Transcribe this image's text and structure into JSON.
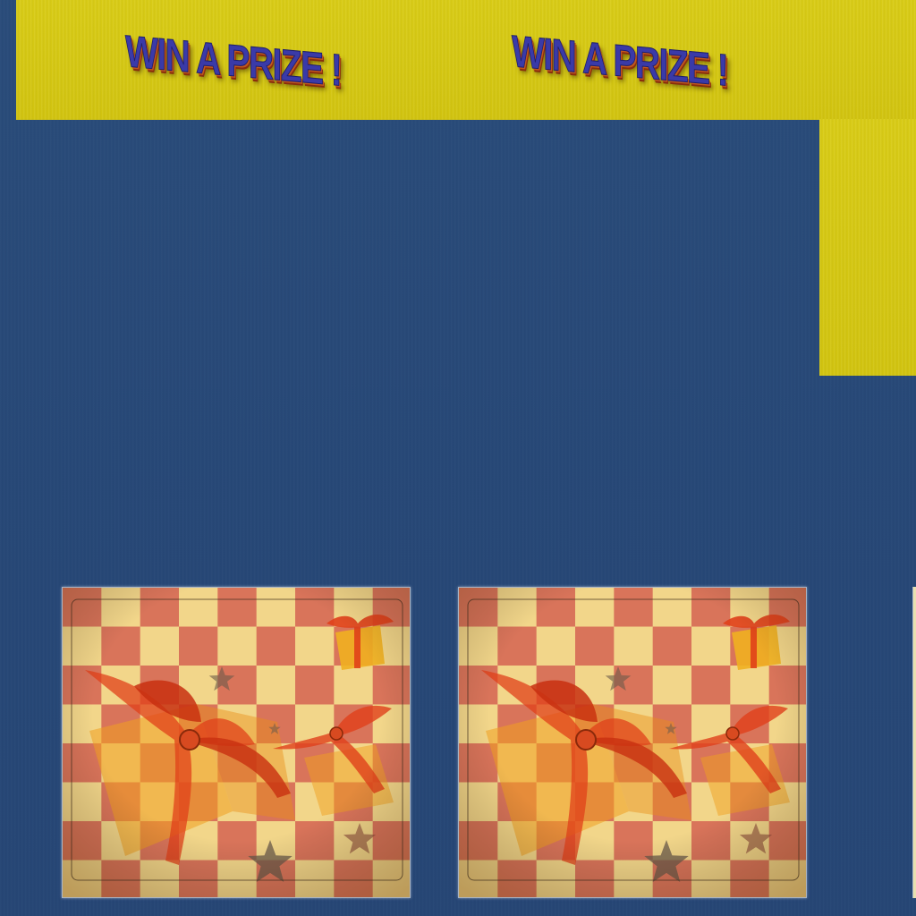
{
  "banner": {
    "titles": [
      "WIN A PRIZE !",
      "WIN A PRIZE !"
    ],
    "color": "#d6c913"
  },
  "background_color": "#284a78",
  "cards": [
    {
      "pattern": "checkerboard-gifts",
      "icons": [
        "gift-icon",
        "bow-icon",
        "star-icon"
      ]
    },
    {
      "pattern": "checkerboard-gifts",
      "icons": [
        "gift-icon",
        "bow-icon",
        "star-icon"
      ]
    }
  ],
  "colors": {
    "check_light": "#f2d68a",
    "check_dark": "#d9745a",
    "ribbon": "#e0401a",
    "gift": "#f0a020",
    "star": "#6a5a4a"
  }
}
